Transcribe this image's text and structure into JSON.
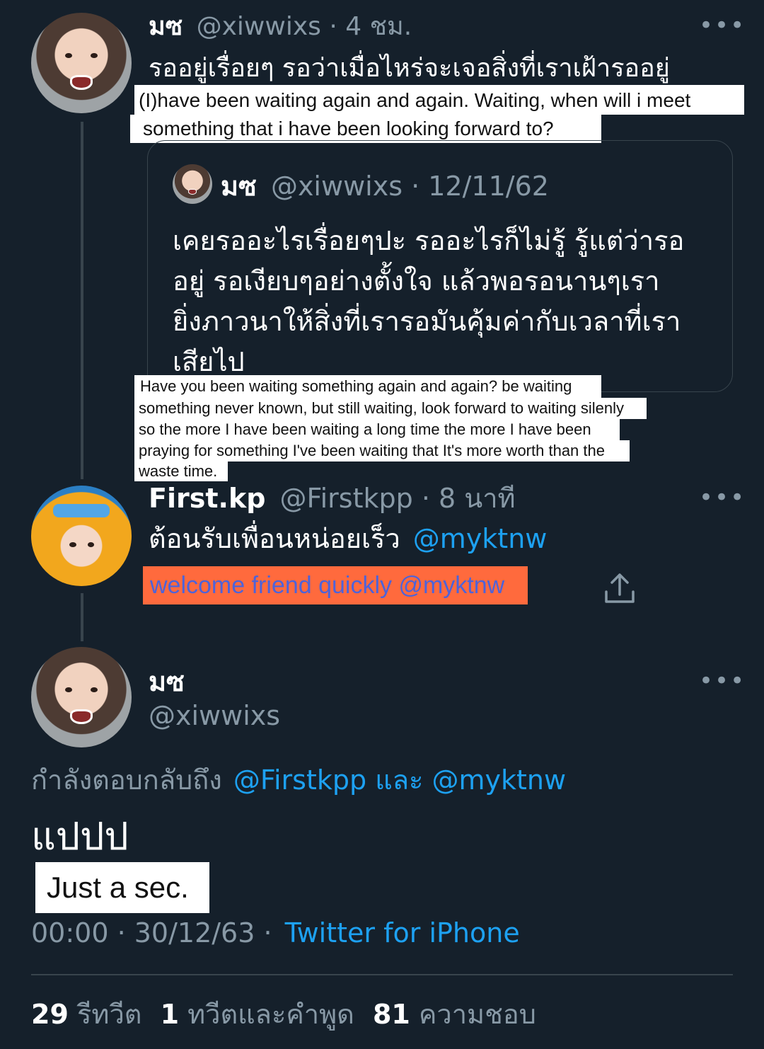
{
  "tweet1": {
    "name": "มซ",
    "handle": "@xiwwixs",
    "time": "· 4 ชม.",
    "more": "•••",
    "text": "รออยู่เรื่อยๆ รอว่าเมื่อไหร่จะเจอสิ่งที่เราเฝ้ารออยู่",
    "translation_line1": "(I)have been waiting again and again. Waiting, when will i meet",
    "translation_line2": "something that i have been looking forward to?"
  },
  "quoted": {
    "name": "มซ",
    "handle": "@xiwwixs",
    "date": "· 12/11/62",
    "lines": [
      "เคยรออะไรเรื่อยๆปะ รออะไรก็ไม่รู้ รู้แต่ว่ารอ",
      "อยู่ รอเงียบๆอย่างตั้งใจ แล้วพอรอนานๆเรา",
      "ยิ่งภาวนาให้สิ่งที่เรารอมันคุ้มค่ากับเวลาที่เรา",
      "เสียไป"
    ],
    "translation_lines": [
      "Have you been waiting something again and again? be waiting",
      "something never known, but still waiting, look forward to waiting silenly",
      "so the more I have been waiting a long time the more I have been",
      "praying for something I've been waiting that It's more worth than the",
      "waste time."
    ]
  },
  "tweet2": {
    "name": "First.kp",
    "handle": "@Firstkpp",
    "time": "· 8 นาที",
    "more": "•••",
    "text": "ต้อนรับเพื่อนหน่อยเร็ว",
    "mention": "@myktnw",
    "translation": "welcome friend quickly @myktnw"
  },
  "tweet3": {
    "name": "มซ",
    "handle": "@xiwwixs",
    "more": "•••",
    "reply_prefix": "กำลังตอบกลับถึง",
    "reply_user1": "@Firstkpp",
    "reply_and": "และ",
    "reply_user2": "@myktnw",
    "text": "แปปป",
    "translation": "Just a sec.",
    "timestamp": "00:00 · 30/12/63 ·",
    "source": "Twitter for iPhone"
  },
  "stats": {
    "retweets_count": "29",
    "retweets_label": "รีทวีต",
    "quotes_count": "1",
    "quotes_label": "ทวีตและคำพูด",
    "likes_count": "81",
    "likes_label": "ความชอบ"
  },
  "colors": {
    "background": "#15202b",
    "accent": "#1da1f2",
    "muted": "#8899a6",
    "highlight": "#ff6a3d"
  }
}
